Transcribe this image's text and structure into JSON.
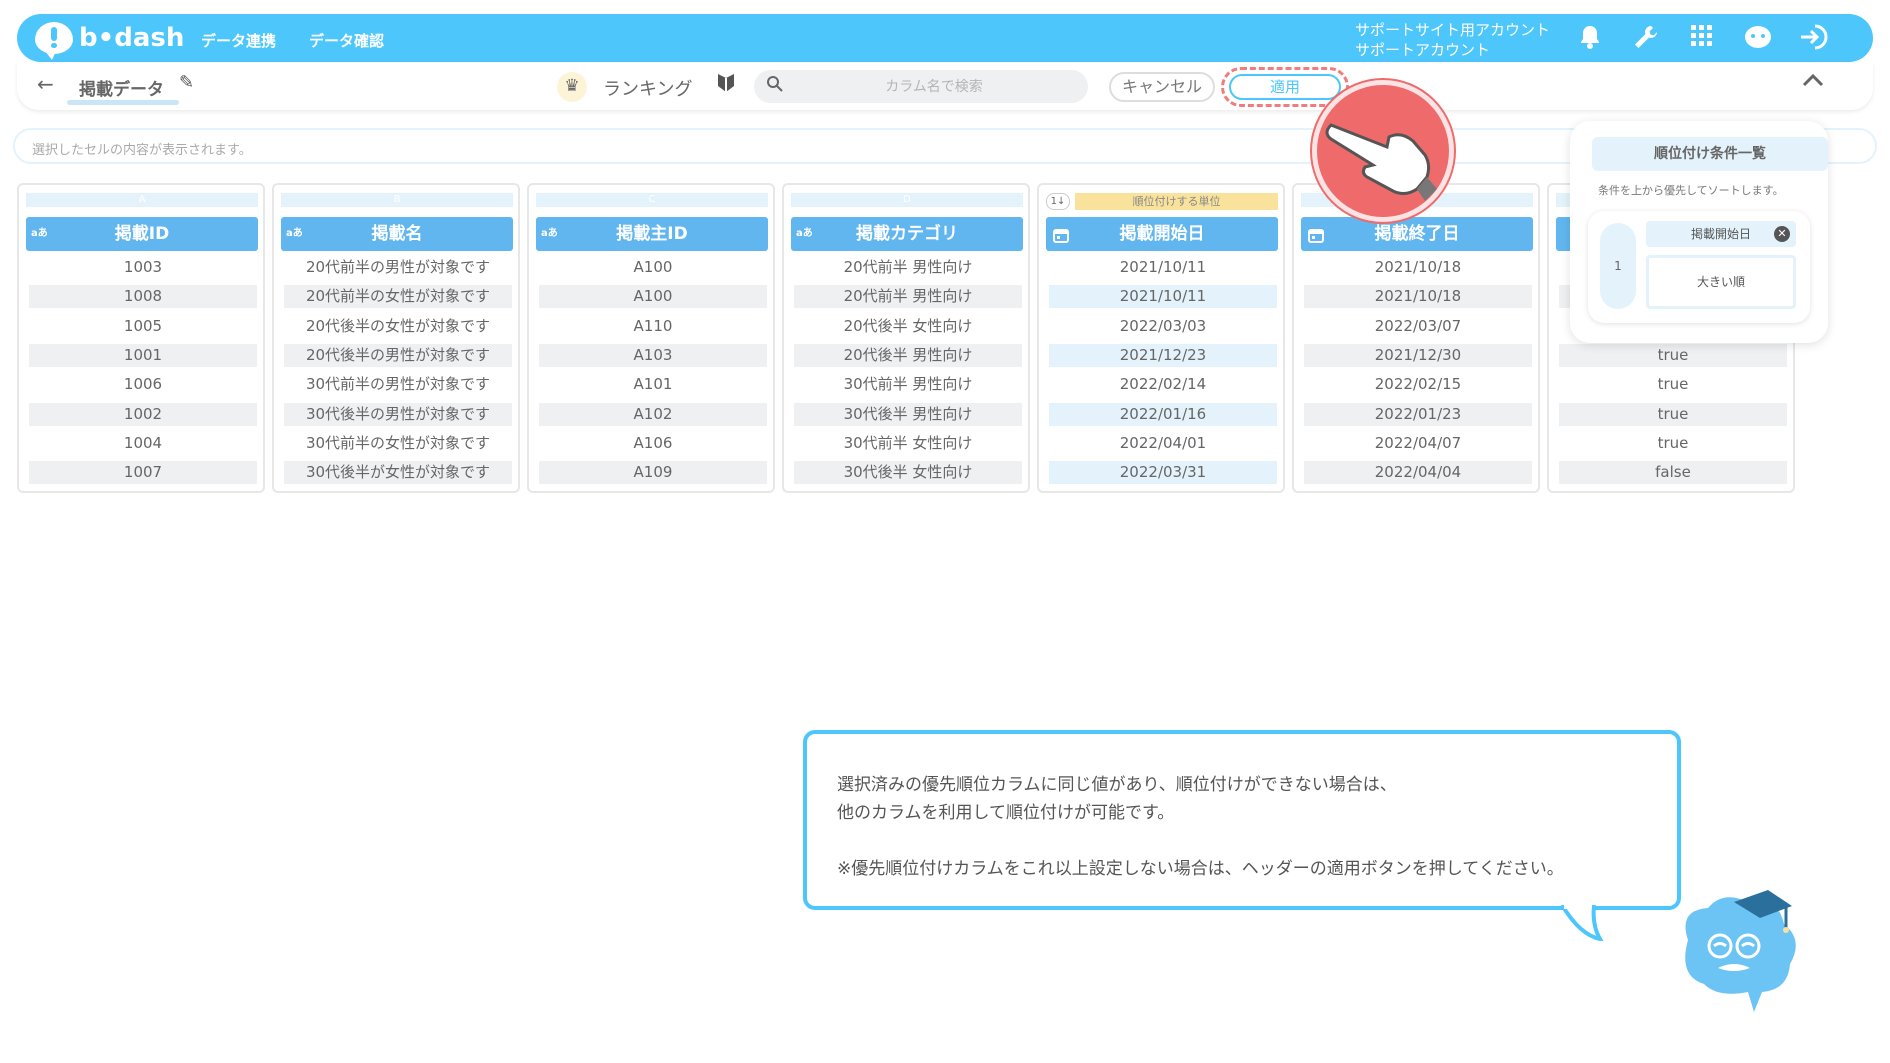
{
  "header": {
    "logo_text": "b•dash",
    "nav": [
      "データ連携",
      "データ確認"
    ],
    "account_line1": "サポートサイト用アカウント",
    "account_line2": "サポートアカウント"
  },
  "toolbar": {
    "data_name": "掲載データ",
    "ranking_label": "ランキング",
    "search_placeholder": "カラム名で検索",
    "cancel_label": "キャンセル",
    "apply_label": "適用"
  },
  "cell_display": {
    "placeholder": "選択したセルの内容が表示されます。"
  },
  "table": {
    "columns": [
      {
        "letter": "A",
        "type": "aあ",
        "header": "掲載ID",
        "cells": [
          "1003",
          "1008",
          "1005",
          "1001",
          "1006",
          "1002",
          "1004",
          "1007"
        ]
      },
      {
        "letter": "B",
        "type": "aあ",
        "header": "掲載名",
        "cells": [
          "20代前半の男性が対象です",
          "20代前半の女性が対象です",
          "20代後半の女性が対象です",
          "20代後半の男性が対象です",
          "30代前半の男性が対象です",
          "30代後半の男性が対象です",
          "30代前半の女性が対象です",
          "30代後半が女性が対象です"
        ]
      },
      {
        "letter": "C",
        "type": "aあ",
        "header": "掲載主ID",
        "cells": [
          "A100",
          "A100",
          "A110",
          "A103",
          "A101",
          "A102",
          "A106",
          "A109"
        ]
      },
      {
        "letter": "D",
        "type": "aあ",
        "header": "掲載カテゴリ",
        "cells": [
          "20代前半 男性向け",
          "20代前半 男性向け",
          "20代後半 女性向け",
          "20代後半 男性向け",
          "30代前半 男性向け",
          "30代後半 男性向け",
          "30代前半 女性向け",
          "30代後半 女性向け"
        ]
      },
      {
        "letter": "",
        "type": "calendar",
        "header": "掲載開始日",
        "priority_label": "順位付けする単位",
        "priority_icon": "1↓",
        "cells": [
          "2021/10/11",
          "2021/10/11",
          "2022/03/03",
          "2021/12/23",
          "2022/02/14",
          "2022/01/16",
          "2022/04/01",
          "2022/03/31"
        ]
      },
      {
        "letter": "",
        "type": "calendar",
        "header": "掲載終了日",
        "cells": [
          "2021/10/18",
          "2021/10/18",
          "2022/03/07",
          "2021/12/30",
          "2022/02/15",
          "2022/01/23",
          "2022/04/07",
          "2022/04/04"
        ]
      },
      {
        "letter": "",
        "type": "",
        "header": "",
        "cells": [
          "",
          "",
          "",
          "true",
          "true",
          "true",
          "true",
          "false"
        ]
      }
    ]
  },
  "ranking_panel": {
    "title": "順位付け条件一覧",
    "subtitle": "条件を上から優先してソートします。",
    "rank_number": "1",
    "field": "掲載開始日",
    "order": "大きい順"
  },
  "balloon": {
    "line1": "選択済みの優先順位カラムに同じ値があり、順位付けができない場合は、",
    "line2": "他のカラムを利用して順位付けが可能です。",
    "line3": "※優先順位付けカラムをこれ以上設定しない場合は、ヘッダーの適用ボタンを押してください。"
  },
  "colors": {
    "brand": "#4cc6fb",
    "header_blue": "#62b6ef",
    "highlight": "#ef6a6a",
    "priority": "#f9e39c"
  }
}
